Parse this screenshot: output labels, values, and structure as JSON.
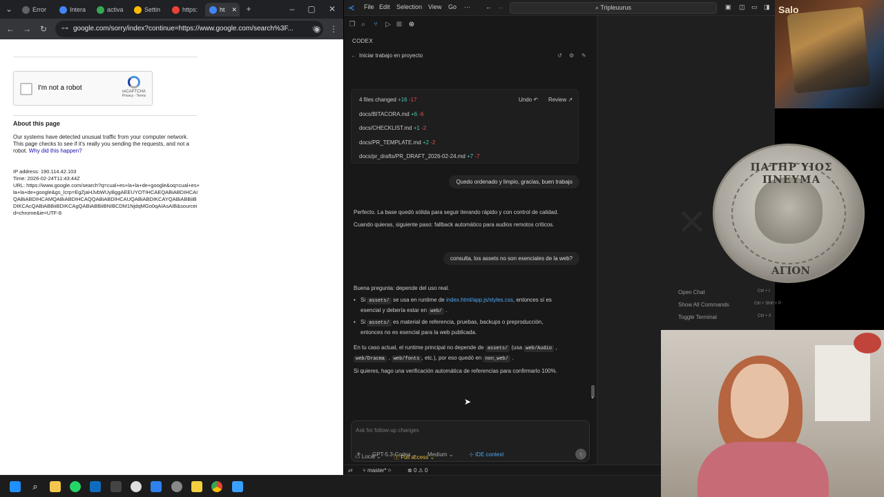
{
  "chrome": {
    "tabs": [
      {
        "label": "Error"
      },
      {
        "label": "Intera"
      },
      {
        "label": "activa"
      },
      {
        "label": "Settin"
      },
      {
        "label": "https:"
      },
      {
        "label": "ht"
      }
    ],
    "url": "google.com/sorry/index?continue=https://www.google.com/search%3F...",
    "recaptcha": {
      "label": "I'm not a robot",
      "brand": "reCAPTCHA",
      "terms": "Privacy - Terms"
    },
    "about_title": "About this page",
    "about_text": "Our systems have detected unusual traffic from your computer network. This page checks to see if it's really you sending the requests, and not a robot.",
    "about_link": "Why did this happen?",
    "ip": "IP address: 190.114.42.103",
    "time": "Time: 2026-02-24T11:43:44Z",
    "url_info": "URL: https://www.google.com/search?q=cual+es+la+la+de+google&oq=cual+es+la+la+de+google&gs_lcrp=EgZjaHJvbWUyBggAEEUYOTIHCAEQABiABDIHCAIQABiABDIHCAMQABiABDIHCAQQABiABDIHCAUQABiABDIKCAYQABiABBiiBDIKCAcQABiABBiiBDIKCAgQABiABBiiBNIBCDM1NjdqMGo0qAIAsAIB&sourceid=chrome&ie=UTF-8"
  },
  "vscode": {
    "menu": [
      "File",
      "Edit",
      "Selection",
      "View",
      "Go"
    ],
    "menu_more": "···",
    "search_label": "Tripleuurus",
    "panel_title": "CODEX",
    "thread_title": "Iniciar trabajo en proyecto",
    "files_summary": {
      "label": "4 files changed",
      "add": "+16",
      "del": "-17",
      "undo": "Undo",
      "review": "Review"
    },
    "files": [
      {
        "name": "docs/BITACORA.md",
        "add": "+6",
        "del": "-6"
      },
      {
        "name": "docs/CHECKLIST.md",
        "add": "+1",
        "del": "-2"
      },
      {
        "name": "docs/PR_TEMPLATE.md",
        "add": "+2",
        "del": "-2"
      },
      {
        "name": "docs/pr_drafts/PR_DRAFT_2026-02-24.md",
        "add": "+7",
        "del": "-7"
      }
    ],
    "user_msg_1": "Quedo ordenado y limpio, gracias, buen trabajo",
    "assistant_1a": "Perfecto. La base quedó sólida para seguir iterando rápido y con control de calidad.",
    "assistant_1b": "Cuando quieras, siguiente paso: fallback automático para audios remotos críticos.",
    "user_msg_2": "consulta, los assets no son esenciales de la web?",
    "assistant_2_intro": "Buena pregunta: depende del uso real.",
    "bullet1_pre": "Si",
    "bullet1_code": "assets/",
    "bullet1_mid": "se usa en runtime de",
    "bullet1_link": "index.html/app.js/styles.css",
    "bullet1_post": ", entonces sí es",
    "bullet1_line2": "esencial y debería estar en",
    "bullet1_code2": "web/",
    "bullet2_pre": "Si",
    "bullet2_code": "assets/",
    "bullet2_post": "es material de referencia, pruebas, backups o preproducción,",
    "bullet2_line2": "entonces no es esencial para la web publicada.",
    "para_pre": "En tu caso actual, el runtime principal no depende de",
    "para_code1": "assets/",
    "para_mid": "(usa",
    "para_code2": "web/Audio",
    "para_code3": "web/Dracma",
    "para_code4": "web/fonts",
    "para_post": ", etc.), por eso quedó en",
    "para_code5": "non_web/",
    "closing": "Si quieres, hago una verificación automática de referencias para confirmarlo 100%.",
    "composer_placeholder": "Ask for follow-up changes",
    "model": "GPT-5.3-Codex",
    "effort": "Medium",
    "ide_context": "IDE context",
    "env": "Local",
    "access": "Full access",
    "branch": "master*",
    "problems": "0",
    "warnings": "0",
    "commands": [
      {
        "label": "Open Chat",
        "keys": "Ctrl + I"
      },
      {
        "label": "Show All Commands",
        "keys": "Ctrl + Shift + P"
      },
      {
        "label": "Toggle Terminal",
        "keys": "Ctrl + ñ"
      }
    ]
  },
  "overlay": {
    "stream_name": "Salo",
    "coin_text": "ΠΑΤΗΡ ΥΙΟΣ ΠΝΕΥΜΑ",
    "coin_bottom": "ΑΓΙΟΝ"
  },
  "colors": {
    "accent": "#4daafc",
    "add": "#4ec9b0",
    "del": "#f14c4c",
    "chrome_dark": "#202124"
  }
}
